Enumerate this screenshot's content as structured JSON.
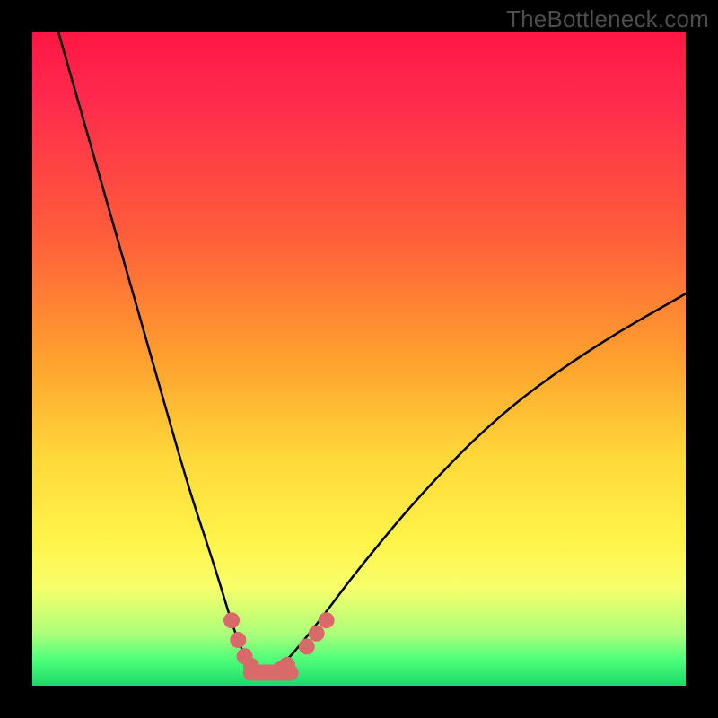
{
  "watermark": "TheBottleneck.com",
  "chart_data": {
    "type": "line",
    "title": "",
    "xlabel": "",
    "ylabel": "",
    "xlim": [
      0,
      100
    ],
    "ylim": [
      0,
      100
    ],
    "series": [
      {
        "name": "bottleneck-curve",
        "x": [
          4,
          8,
          12,
          16,
          20,
          24,
          28,
          31,
          33,
          34.5,
          36,
          38,
          40,
          44,
          50,
          60,
          72,
          86,
          100
        ],
        "y": [
          100,
          86,
          72,
          58,
          44,
          30,
          18,
          8,
          3.5,
          2,
          2,
          3,
          5,
          10,
          18,
          30,
          42,
          52,
          60
        ]
      }
    ],
    "markers": {
      "name": "highlight-points",
      "color": "#d86a6a",
      "points": [
        {
          "x": 30.5,
          "y": 10
        },
        {
          "x": 31.5,
          "y": 7
        },
        {
          "x": 32.5,
          "y": 4.5
        },
        {
          "x": 33.5,
          "y": 3
        },
        {
          "x": 35.0,
          "y": 2
        },
        {
          "x": 36.5,
          "y": 2
        },
        {
          "x": 38.0,
          "y": 2.5
        },
        {
          "x": 39.0,
          "y": 3.2
        },
        {
          "x": 42.0,
          "y": 6
        },
        {
          "x": 43.5,
          "y": 8
        },
        {
          "x": 45.0,
          "y": 10
        }
      ],
      "bar": {
        "x_start": 33.5,
        "x_end": 39.5,
        "y": 2
      }
    }
  }
}
